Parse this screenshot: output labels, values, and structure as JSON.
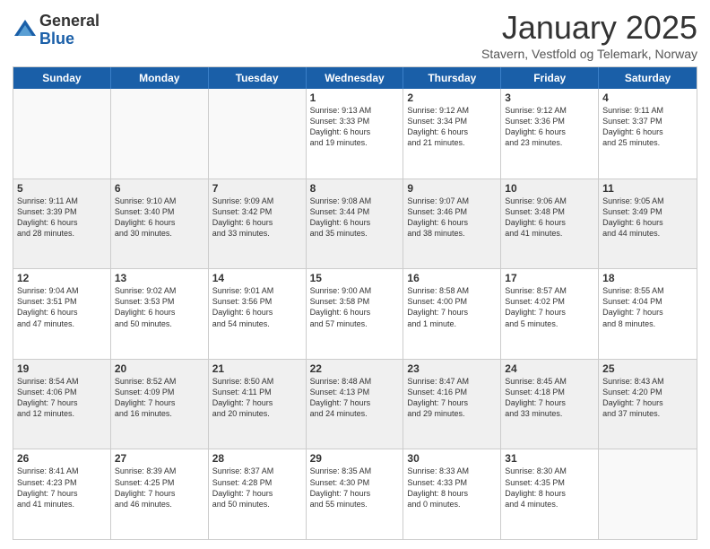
{
  "logo": {
    "general": "General",
    "blue": "Blue"
  },
  "title": "January 2025",
  "location": "Stavern, Vestfold og Telemark, Norway",
  "days": [
    "Sunday",
    "Monday",
    "Tuesday",
    "Wednesday",
    "Thursday",
    "Friday",
    "Saturday"
  ],
  "weeks": [
    [
      {
        "day": "",
        "info": ""
      },
      {
        "day": "",
        "info": ""
      },
      {
        "day": "",
        "info": ""
      },
      {
        "day": "1",
        "info": "Sunrise: 9:13 AM\nSunset: 3:33 PM\nDaylight: 6 hours\nand 19 minutes."
      },
      {
        "day": "2",
        "info": "Sunrise: 9:12 AM\nSunset: 3:34 PM\nDaylight: 6 hours\nand 21 minutes."
      },
      {
        "day": "3",
        "info": "Sunrise: 9:12 AM\nSunset: 3:36 PM\nDaylight: 6 hours\nand 23 minutes."
      },
      {
        "day": "4",
        "info": "Sunrise: 9:11 AM\nSunset: 3:37 PM\nDaylight: 6 hours\nand 25 minutes."
      }
    ],
    [
      {
        "day": "5",
        "info": "Sunrise: 9:11 AM\nSunset: 3:39 PM\nDaylight: 6 hours\nand 28 minutes."
      },
      {
        "day": "6",
        "info": "Sunrise: 9:10 AM\nSunset: 3:40 PM\nDaylight: 6 hours\nand 30 minutes."
      },
      {
        "day": "7",
        "info": "Sunrise: 9:09 AM\nSunset: 3:42 PM\nDaylight: 6 hours\nand 33 minutes."
      },
      {
        "day": "8",
        "info": "Sunrise: 9:08 AM\nSunset: 3:44 PM\nDaylight: 6 hours\nand 35 minutes."
      },
      {
        "day": "9",
        "info": "Sunrise: 9:07 AM\nSunset: 3:46 PM\nDaylight: 6 hours\nand 38 minutes."
      },
      {
        "day": "10",
        "info": "Sunrise: 9:06 AM\nSunset: 3:48 PM\nDaylight: 6 hours\nand 41 minutes."
      },
      {
        "day": "11",
        "info": "Sunrise: 9:05 AM\nSunset: 3:49 PM\nDaylight: 6 hours\nand 44 minutes."
      }
    ],
    [
      {
        "day": "12",
        "info": "Sunrise: 9:04 AM\nSunset: 3:51 PM\nDaylight: 6 hours\nand 47 minutes."
      },
      {
        "day": "13",
        "info": "Sunrise: 9:02 AM\nSunset: 3:53 PM\nDaylight: 6 hours\nand 50 minutes."
      },
      {
        "day": "14",
        "info": "Sunrise: 9:01 AM\nSunset: 3:56 PM\nDaylight: 6 hours\nand 54 minutes."
      },
      {
        "day": "15",
        "info": "Sunrise: 9:00 AM\nSunset: 3:58 PM\nDaylight: 6 hours\nand 57 minutes."
      },
      {
        "day": "16",
        "info": "Sunrise: 8:58 AM\nSunset: 4:00 PM\nDaylight: 7 hours\nand 1 minute."
      },
      {
        "day": "17",
        "info": "Sunrise: 8:57 AM\nSunset: 4:02 PM\nDaylight: 7 hours\nand 5 minutes."
      },
      {
        "day": "18",
        "info": "Sunrise: 8:55 AM\nSunset: 4:04 PM\nDaylight: 7 hours\nand 8 minutes."
      }
    ],
    [
      {
        "day": "19",
        "info": "Sunrise: 8:54 AM\nSunset: 4:06 PM\nDaylight: 7 hours\nand 12 minutes."
      },
      {
        "day": "20",
        "info": "Sunrise: 8:52 AM\nSunset: 4:09 PM\nDaylight: 7 hours\nand 16 minutes."
      },
      {
        "day": "21",
        "info": "Sunrise: 8:50 AM\nSunset: 4:11 PM\nDaylight: 7 hours\nand 20 minutes."
      },
      {
        "day": "22",
        "info": "Sunrise: 8:48 AM\nSunset: 4:13 PM\nDaylight: 7 hours\nand 24 minutes."
      },
      {
        "day": "23",
        "info": "Sunrise: 8:47 AM\nSunset: 4:16 PM\nDaylight: 7 hours\nand 29 minutes."
      },
      {
        "day": "24",
        "info": "Sunrise: 8:45 AM\nSunset: 4:18 PM\nDaylight: 7 hours\nand 33 minutes."
      },
      {
        "day": "25",
        "info": "Sunrise: 8:43 AM\nSunset: 4:20 PM\nDaylight: 7 hours\nand 37 minutes."
      }
    ],
    [
      {
        "day": "26",
        "info": "Sunrise: 8:41 AM\nSunset: 4:23 PM\nDaylight: 7 hours\nand 41 minutes."
      },
      {
        "day": "27",
        "info": "Sunrise: 8:39 AM\nSunset: 4:25 PM\nDaylight: 7 hours\nand 46 minutes."
      },
      {
        "day": "28",
        "info": "Sunrise: 8:37 AM\nSunset: 4:28 PM\nDaylight: 7 hours\nand 50 minutes."
      },
      {
        "day": "29",
        "info": "Sunrise: 8:35 AM\nSunset: 4:30 PM\nDaylight: 7 hours\nand 55 minutes."
      },
      {
        "day": "30",
        "info": "Sunrise: 8:33 AM\nSunset: 4:33 PM\nDaylight: 8 hours\nand 0 minutes."
      },
      {
        "day": "31",
        "info": "Sunrise: 8:30 AM\nSunset: 4:35 PM\nDaylight: 8 hours\nand 4 minutes."
      },
      {
        "day": "",
        "info": ""
      }
    ]
  ]
}
